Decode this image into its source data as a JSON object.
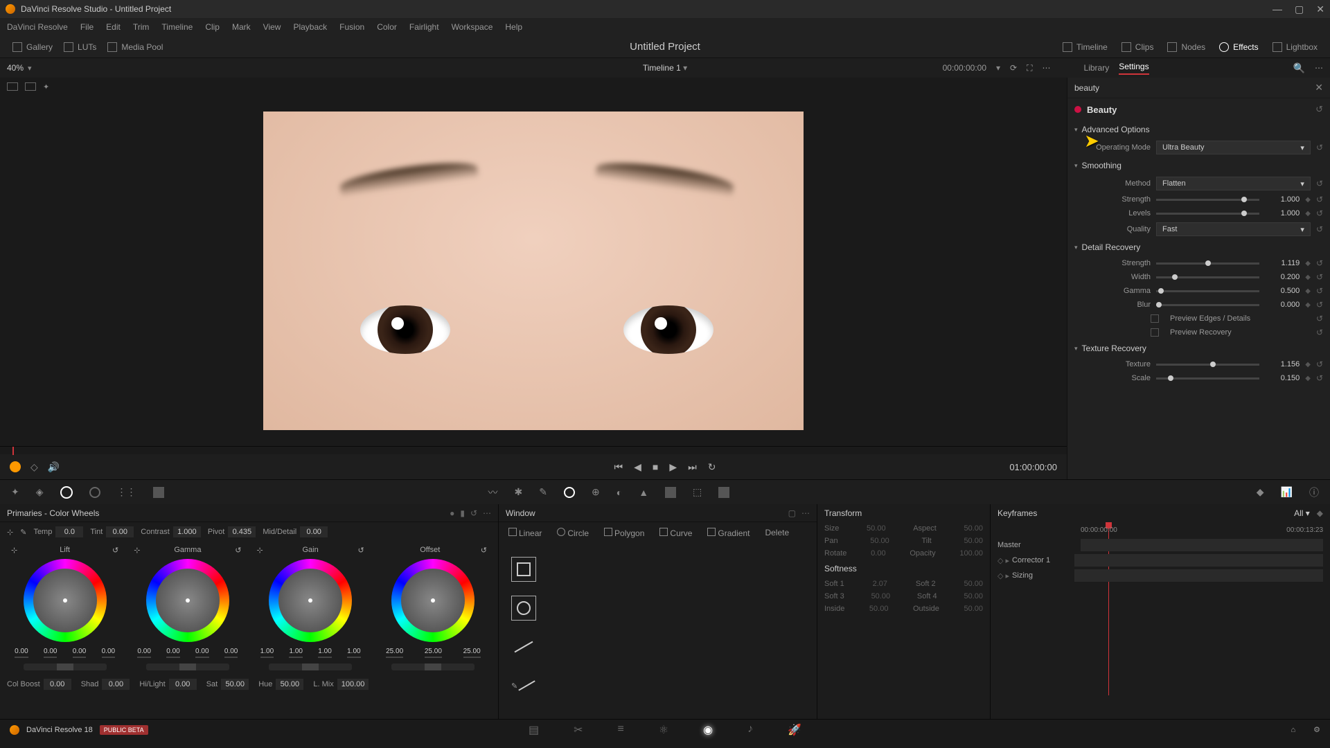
{
  "titlebar": {
    "title": "DaVinci Resolve Studio - Untitled Project"
  },
  "menubar": [
    "DaVinci Resolve",
    "File",
    "Edit",
    "Trim",
    "Timeline",
    "Clip",
    "Mark",
    "View",
    "Playback",
    "Fusion",
    "Color",
    "Fairlight",
    "Workspace",
    "Help"
  ],
  "toolbar": {
    "left": [
      "Gallery",
      "LUTs",
      "Media Pool"
    ],
    "center": "Untitled Project",
    "right": [
      "Timeline",
      "Clips",
      "Nodes",
      "Effects",
      "Lightbox"
    ]
  },
  "subbar": {
    "zoom": "40%",
    "timeline_name": "Timeline 1",
    "timecode": "00:00:00:00",
    "tabs": {
      "library": "Library",
      "settings": "Settings"
    }
  },
  "fx": {
    "search": "beauty",
    "title": "Beauty",
    "sections": {
      "advanced": {
        "label": "Advanced Options",
        "operating_mode_label": "Operating Mode",
        "operating_mode_value": "Ultra Beauty"
      },
      "smoothing": {
        "label": "Smoothing",
        "method_label": "Method",
        "method_value": "Flatten",
        "strength_label": "Strength",
        "strength_value": "1.000",
        "levels_label": "Levels",
        "levels_value": "1.000",
        "quality_label": "Quality",
        "quality_value": "Fast"
      },
      "detail": {
        "label": "Detail Recovery",
        "strength_label": "Strength",
        "strength_value": "1.119",
        "width_label": "Width",
        "width_value": "0.200",
        "gamma_label": "Gamma",
        "gamma_value": "0.500",
        "blur_label": "Blur",
        "blur_value": "0.000",
        "preview_edges": "Preview Edges / Details",
        "preview_recovery": "Preview Recovery"
      },
      "texture": {
        "label": "Texture Recovery",
        "texture_label": "Texture",
        "texture_value": "1.156",
        "scale_label": "Scale",
        "scale_value": "0.150"
      }
    }
  },
  "transport": {
    "timecode": "01:00:00:00"
  },
  "wheels": {
    "title": "Primaries - Color Wheels",
    "adjust": {
      "temp_label": "Temp",
      "temp": "0.0",
      "tint_label": "Tint",
      "tint": "0.00",
      "contrast_label": "Contrast",
      "contrast": "1.000",
      "pivot_label": "Pivot",
      "pivot": "0.435",
      "md_label": "Mid/Detail",
      "md": "0.00"
    },
    "groups": {
      "lift": {
        "label": "Lift",
        "vals": [
          "0.00",
          "0.00",
          "0.00",
          "0.00"
        ]
      },
      "gamma": {
        "label": "Gamma",
        "vals": [
          "0.00",
          "0.00",
          "0.00",
          "0.00"
        ]
      },
      "gain": {
        "label": "Gain",
        "vals": [
          "1.00",
          "1.00",
          "1.00",
          "1.00"
        ]
      },
      "offset": {
        "label": "Offset",
        "vals": [
          "25.00",
          "25.00",
          "25.00"
        ]
      }
    },
    "bottom": {
      "colboost_label": "Col Boost",
      "colboost": "0.00",
      "shad_label": "Shad",
      "shad": "0.00",
      "hilight_label": "Hi/Light",
      "hilight": "0.00",
      "sat_label": "Sat",
      "sat": "50.00",
      "hue_label": "Hue",
      "hue": "50.00",
      "lmix_label": "L. Mix",
      "lmix": "100.00"
    }
  },
  "window": {
    "title": "Window",
    "shapes": [
      "Linear",
      "Circle",
      "Polygon",
      "Curve",
      "Gradient",
      "Delete"
    ]
  },
  "transform": {
    "title": "Transform",
    "size_label": "Size",
    "size": "50.00",
    "aspect_label": "Aspect",
    "aspect": "50.00",
    "pan_label": "Pan",
    "pan": "50.00",
    "tilt_label": "Tilt",
    "tilt": "50.00",
    "rotate_label": "Rotate",
    "rotate": "0.00",
    "opacity_label": "Opacity",
    "opacity": "100.00",
    "softness": "Softness",
    "soft1_label": "Soft 1",
    "soft1": "2.07",
    "soft2_label": "Soft 2",
    "soft2": "50.00",
    "soft3_label": "Soft 3",
    "soft3": "50.00",
    "soft4_label": "Soft 4",
    "soft4": "50.00",
    "inside_label": "Inside",
    "inside": "50.00",
    "outside_label": "Outside",
    "outside": "50.00"
  },
  "keyframes": {
    "title": "Keyframes",
    "all": "All",
    "tc_start": "00:00:00:00",
    "tc_mid": "00:00:00:00",
    "tc_end": "00:00:13:23",
    "tracks": {
      "master": "Master",
      "corrector": "Corrector 1",
      "sizing": "Sizing"
    }
  },
  "status": {
    "app": "DaVinci Resolve 18",
    "tag": "PUBLIC BETA"
  }
}
